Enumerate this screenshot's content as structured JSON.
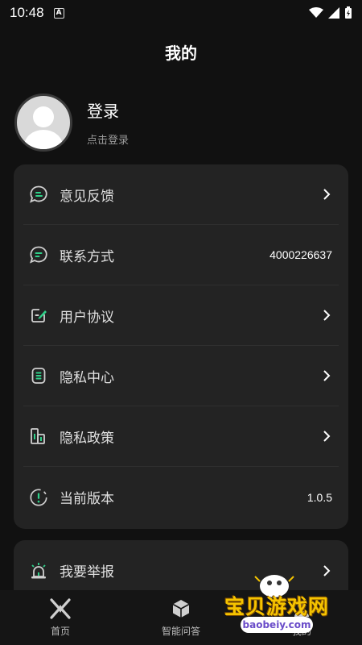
{
  "status_bar": {
    "time": "10:48",
    "notif_letter": "A"
  },
  "header": {
    "title": "我的"
  },
  "profile": {
    "name": "登录",
    "subtitle": "点击登录"
  },
  "menu": {
    "feedback": {
      "label": "意见反馈",
      "icon": "feedback-chat-icon"
    },
    "contact": {
      "label": "联系方式",
      "value": "4000226637",
      "icon": "chat-bubble-icon"
    },
    "agreement": {
      "label": "用户协议",
      "icon": "edit-document-icon"
    },
    "privacy_center": {
      "label": "隐私中心",
      "icon": "privacy-list-icon"
    },
    "privacy_policy": {
      "label": "隐私政策",
      "icon": "policy-building-icon"
    },
    "version": {
      "label": "当前版本",
      "value": "1.0.5",
      "icon": "info-alert-icon"
    }
  },
  "report": {
    "label": "我要举报",
    "icon": "alarm-siren-icon"
  },
  "bottom_nav": [
    {
      "label": "首页",
      "icon": "home-logo-icon"
    },
    {
      "label": "智能问答",
      "icon": "cube-icon"
    },
    {
      "label": "我的",
      "icon": "profile-icon"
    }
  ],
  "watermark": {
    "text": "宝贝游戏网",
    "url": "baobeiy.com"
  },
  "colors": {
    "accent": "#2fd18a",
    "background": "#111111",
    "card": "#232323"
  }
}
